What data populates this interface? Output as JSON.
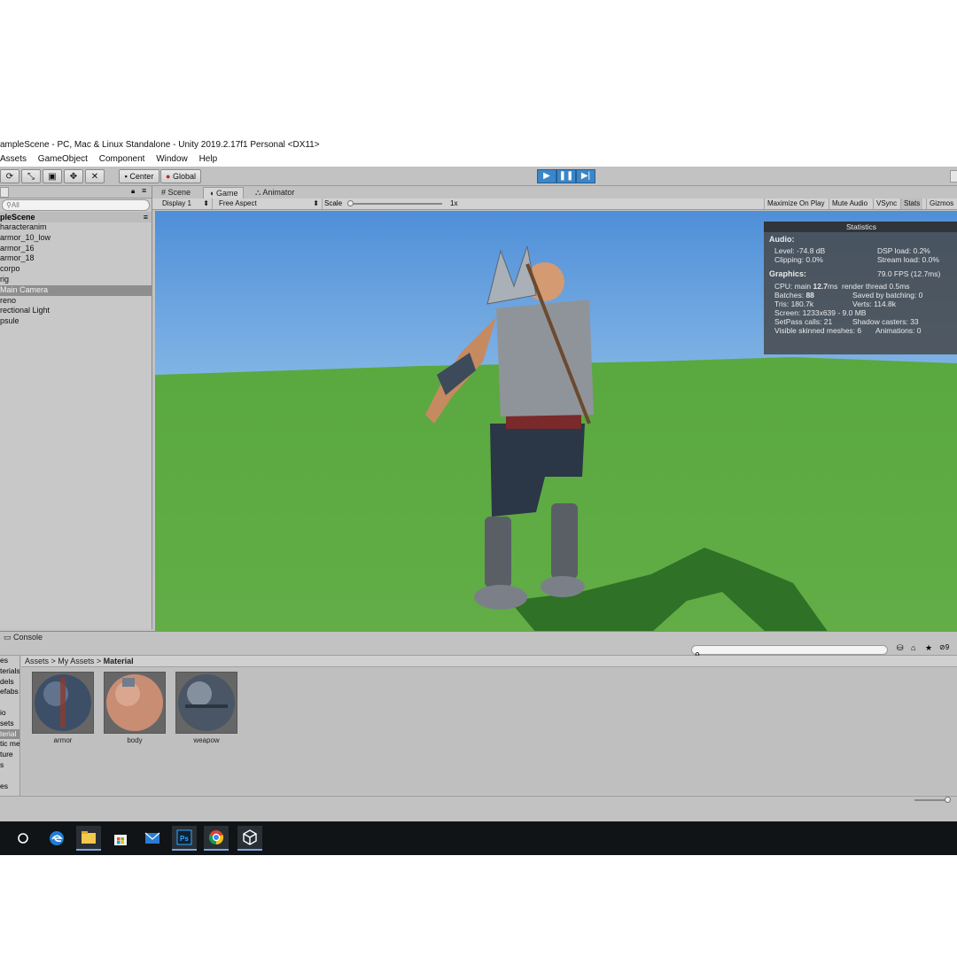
{
  "window": {
    "title": "ampleScene - PC, Mac & Linux Standalone - Unity 2019.2.17f1 Personal <DX11>"
  },
  "menu": [
    "Assets",
    "GameObject",
    "Component",
    "Window",
    "Help"
  ],
  "toolbar": {
    "pivot_label": "Center",
    "space_label": "Global"
  },
  "hierarchy": {
    "search_placeholder": "All",
    "scene_name": "pleScene",
    "items": [
      {
        "label": "haracteranim",
        "selected": false
      },
      {
        "label": "armor_10_low",
        "selected": false
      },
      {
        "label": "armor_16",
        "selected": false
      },
      {
        "label": "armor_18",
        "selected": false
      },
      {
        "label": "corpo",
        "selected": false
      },
      {
        "label": "rig",
        "selected": false
      },
      {
        "label": "Main Camera",
        "selected": true
      },
      {
        "label": "reno",
        "selected": false
      },
      {
        "label": "rectional Light",
        "selected": false
      },
      {
        "label": "psule",
        "selected": false
      }
    ]
  },
  "view_tabs": {
    "scene": "Scene",
    "game": "Game",
    "animator": "Animator"
  },
  "game_bar": {
    "display": "Display 1",
    "aspect": "Free Aspect",
    "scale_label": "Scale",
    "scale_value": "1x",
    "maximize": "Maximize On Play",
    "mute": "Mute Audio",
    "vsync": "VSync",
    "stats": "Stats",
    "gizmos": "Gizmos"
  },
  "stats": {
    "title": "Statistics",
    "audio_header": "Audio:",
    "level": "Level: -74.8 dB",
    "dsp": "DSP load: 0.2%",
    "clipping": "Clipping: 0.0%",
    "stream": "Stream load: 0.0%",
    "graphics_header": "Graphics:",
    "fps": "79.0 FPS (12.7ms)",
    "cpu_prefix": "CPU: main ",
    "cpu_value": "12.7",
    "cpu_unit": "ms",
    "render_thread": "render thread 0.5ms",
    "batches_prefix": "Batches: ",
    "batches_value": "88",
    "saved": "Saved by batching: 0",
    "tris": "Tris: 180.7k",
    "verts": "Verts: 114.8k",
    "screen": "Screen: 1233x639 - 9.0 MB",
    "setpass": "SetPass calls: 21",
    "shadow": "Shadow casters: 33",
    "skinned": "Visible skinned meshes: 6",
    "animations": "Animations: 0"
  },
  "console": {
    "tab_label": "Console"
  },
  "project": {
    "left_items": [
      {
        "label": "es",
        "selected": false
      },
      {
        "label": "terials",
        "selected": false
      },
      {
        "label": "dels",
        "selected": false
      },
      {
        "label": "efabs",
        "selected": false
      },
      {
        "label": "",
        "selected": false
      },
      {
        "label": "io",
        "selected": false
      },
      {
        "label": "sets",
        "selected": false
      },
      {
        "label": "terial",
        "selected": true
      },
      {
        "label": "tic me",
        "selected": false
      },
      {
        "label": "ture",
        "selected": false
      },
      {
        "label": "s",
        "selected": false
      },
      {
        "label": "",
        "selected": false
      },
      {
        "label": "es",
        "selected": false
      }
    ],
    "breadcrumb": {
      "a": "Assets",
      "b": "My Assets",
      "c": "Material"
    },
    "assets": [
      {
        "label": "armor"
      },
      {
        "label": "body"
      },
      {
        "label": "weapow"
      }
    ],
    "item_count": "9"
  },
  "colors": {
    "accent_blue": "#3a86c8",
    "sky_top": "#4f8fd8",
    "grass": "#5aa840",
    "taskbar": "#111417"
  },
  "taskbar_icons": [
    "cortana-icon",
    "edge-icon",
    "file-explorer-icon",
    "store-icon",
    "mail-icon",
    "photoshop-icon",
    "chrome-icon",
    "unity-icon"
  ]
}
